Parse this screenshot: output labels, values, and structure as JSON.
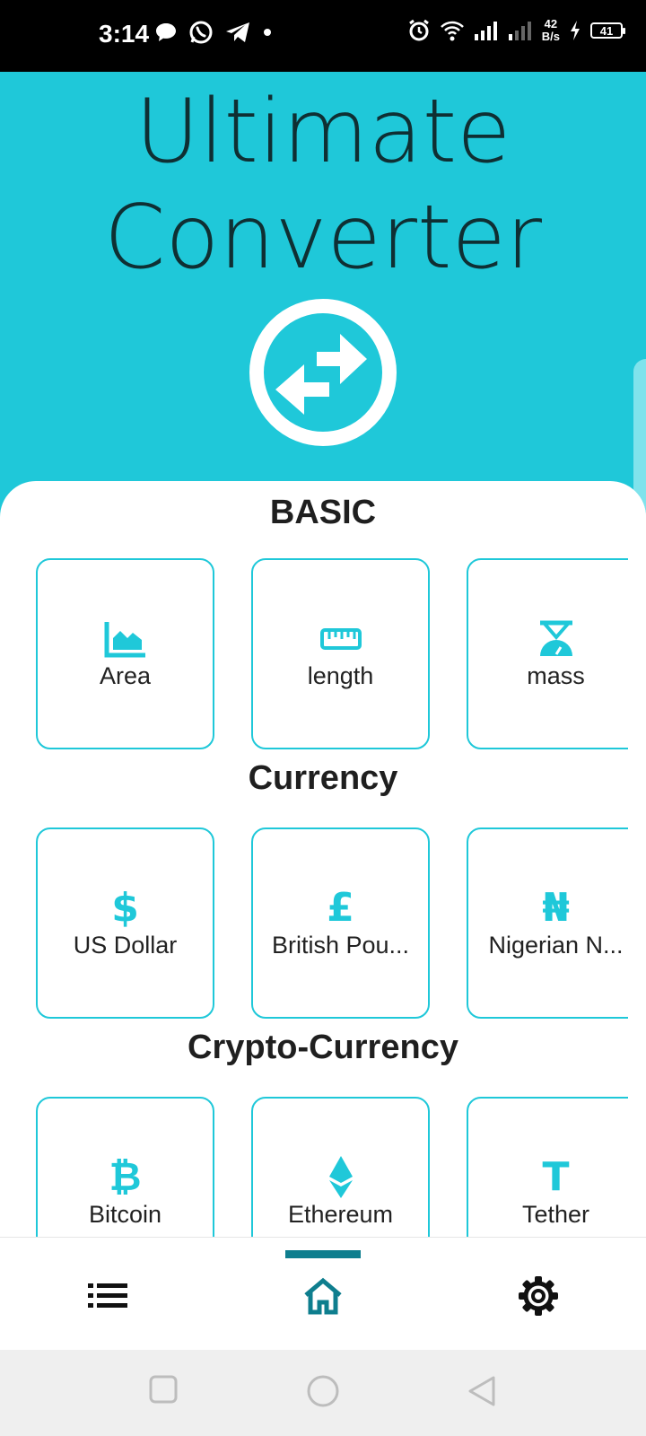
{
  "status_bar": {
    "time": "3:14",
    "net_speed_value": "42",
    "net_speed_unit": "B/s",
    "battery": "41",
    "icons": [
      "chat-bubble-icon",
      "whatsapp-icon",
      "telegram-icon",
      "dot-icon",
      "alarm-icon",
      "wifi-icon",
      "signal-icon",
      "signal-weak-icon",
      "charging-icon",
      "battery-icon"
    ]
  },
  "header": {
    "title_line1": "Ultimate",
    "title_line2": "Converter",
    "logo_icon": "swap-arrows-icon"
  },
  "sections": {
    "basic": {
      "title": "BASIC",
      "items": [
        {
          "label": "Area",
          "icon": "area-chart-icon"
        },
        {
          "label": "length",
          "icon": "ruler-icon"
        },
        {
          "label": "mass",
          "icon": "scale-icon"
        }
      ]
    },
    "currency": {
      "title": "Currency",
      "items": [
        {
          "label": "US Dollar",
          "symbol": "$"
        },
        {
          "label": "British Pou...",
          "symbol": "£"
        },
        {
          "label": "Nigerian N...",
          "symbol": "₦"
        }
      ]
    },
    "crypto": {
      "title": "Crypto-Currency",
      "items": [
        {
          "label": "Bitcoin",
          "symbol": "₿"
        },
        {
          "label": "Ethereum",
          "icon": "ethereum-icon"
        },
        {
          "label": "Tether",
          "symbol": "T"
        }
      ]
    }
  },
  "bottom_nav": {
    "items": [
      {
        "name": "list",
        "icon": "list-icon"
      },
      {
        "name": "home",
        "icon": "home-icon",
        "active": true
      },
      {
        "name": "settings",
        "icon": "gear-icon"
      }
    ]
  },
  "colors": {
    "accent": "#1fc8d9",
    "nav_active": "#0e7e8e",
    "title_text": "#0f2f33"
  }
}
